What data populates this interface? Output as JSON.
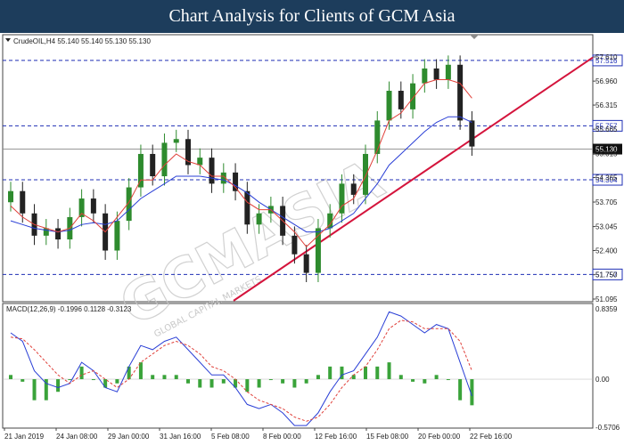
{
  "header": {
    "title": "Chart Analysis for Clients of GCM Asia"
  },
  "price_panel": {
    "info": "CrudeOIL,H4  55.140 55.140 55.130 55.130",
    "watermark": "GCMASIA",
    "watermark_sub": "GLOBAL CAPITAL MARKETS"
  },
  "macd_panel": {
    "info": "MACD(12,26,9) -0.1996 0.1128 -0.3123"
  },
  "colors": {
    "header_bg": "#1d3d5c",
    "bull": "#2e8b2e",
    "bear": "#222222",
    "ma_fast": "#e0403a",
    "ma_slow": "#2a3fd6",
    "trendline": "#d4143c",
    "level_line": "#1f2fb5",
    "macd_line": "#2a3fd6",
    "signal_line": "#e0403a",
    "histogram": "#3aa33a"
  },
  "chart_data": [
    {
      "type": "candlestick",
      "symbol": "CrudeOIL",
      "timeframe": "H4",
      "ohlc": [
        55.14,
        55.14,
        55.13,
        55.13
      ],
      "x_tick_labels": [
        "21 Jan 2019",
        "24 Jan 08:00",
        "29 Jan 00:00",
        "31 Jan 16:00",
        "5 Feb 08:00",
        "8 Feb 00:00",
        "12 Feb 16:00",
        "15 Feb 08:00",
        "20 Feb 00:00",
        "22 Feb 16:00"
      ],
      "y_tick_labels": [
        "57.610",
        "56.960",
        "56.315",
        "55.665",
        "55.015",
        "54.365",
        "53.705",
        "53.045",
        "52.400",
        "51.750",
        "51.095"
      ],
      "ylim": [
        51.095,
        57.61
      ],
      "levels": [
        57.516,
        55.757,
        54.304,
        51.757
      ],
      "current_price": 55.13,
      "trendline": {
        "from": [
          "8 Feb 00:00",
          51.05
        ],
        "to": [
          "22 Feb 16:00",
          55.16
        ]
      },
      "series": [
        {
          "values": [
            54.0,
            53.4,
            52.8,
            53.0,
            52.7,
            53.3,
            53.8,
            53.4,
            52.4,
            53.2,
            54.1,
            55.0,
            54.4,
            55.3,
            55.4,
            54.7,
            54.9,
            54.2,
            54.5,
            54.0,
            53.1,
            53.4,
            53.6,
            52.8,
            52.3,
            51.8,
            53.0,
            53.4,
            54.2,
            53.9,
            55.0,
            55.9,
            56.7,
            56.2,
            56.9,
            57.3,
            57.0,
            57.4,
            55.9,
            55.2
          ]
        },
        {
          "values": [
            53.6,
            53.3,
            53.1,
            53.0,
            52.9,
            53.0,
            53.4,
            53.2,
            52.9,
            53.3,
            53.7,
            54.3,
            54.3,
            54.7,
            55.0,
            54.8,
            54.7,
            54.4,
            54.4,
            54.1,
            53.7,
            53.5,
            53.5,
            53.2,
            52.9,
            52.5,
            52.8,
            53.1,
            53.6,
            53.8,
            54.4,
            55.1,
            55.9,
            56.1,
            56.5,
            56.9,
            57.0,
            57.0,
            56.9,
            56.5
          ]
        },
        {
          "values": [
            53.2,
            53.1,
            53.0,
            52.95,
            52.9,
            52.95,
            53.1,
            53.15,
            53.1,
            53.2,
            53.5,
            53.8,
            54.0,
            54.2,
            54.4,
            54.4,
            54.4,
            54.35,
            54.3,
            54.15,
            53.95,
            53.7,
            53.5,
            53.3,
            53.1,
            52.9,
            52.9,
            53.0,
            53.2,
            53.4,
            53.8,
            54.2,
            54.7,
            55.0,
            55.3,
            55.6,
            55.85,
            56.0,
            56.0,
            55.85
          ]
        }
      ]
    },
    {
      "type": "line",
      "name": "MACD(12,26,9)",
      "values": [
        -0.1996,
        0.1128,
        -0.3123
      ],
      "y_tick_labels": [
        "0.8359",
        "0.00",
        "-0.5706"
      ],
      "ylim": [
        -0.5706,
        0.8359
      ],
      "series": [
        {
          "values": [
            0.55,
            0.45,
            0.1,
            -0.05,
            -0.1,
            -0.05,
            0.2,
            0.1,
            -0.1,
            -0.15,
            0.15,
            0.4,
            0.35,
            0.45,
            0.5,
            0.35,
            0.2,
            0.05,
            0.05,
            -0.1,
            -0.3,
            -0.35,
            -0.3,
            -0.4,
            -0.55,
            -0.55,
            -0.4,
            -0.15,
            0.05,
            0.1,
            0.3,
            0.5,
            0.8,
            0.75,
            0.65,
            0.55,
            0.65,
            0.6,
            0.2,
            -0.2
          ]
        },
        {
          "values": [
            0.5,
            0.48,
            0.35,
            0.2,
            0.05,
            -0.05,
            0.05,
            0.1,
            0.0,
            -0.1,
            0.0,
            0.2,
            0.3,
            0.4,
            0.45,
            0.4,
            0.3,
            0.15,
            0.1,
            0.0,
            -0.15,
            -0.25,
            -0.3,
            -0.35,
            -0.45,
            -0.5,
            -0.45,
            -0.3,
            -0.1,
            0.05,
            0.15,
            0.35,
            0.6,
            0.7,
            0.68,
            0.6,
            0.6,
            0.6,
            0.45,
            0.1
          ]
        },
        {
          "values": [
            0.05,
            -0.03,
            -0.25,
            -0.25,
            -0.15,
            0.0,
            0.15,
            0.0,
            -0.1,
            -0.05,
            0.15,
            0.2,
            0.05,
            0.05,
            0.05,
            -0.05,
            -0.1,
            -0.1,
            -0.05,
            -0.1,
            -0.15,
            -0.1,
            0.0,
            -0.05,
            -0.1,
            -0.05,
            0.05,
            0.15,
            0.15,
            0.05,
            0.15,
            0.15,
            0.2,
            0.05,
            -0.03,
            -0.05,
            0.05,
            0.0,
            -0.25,
            -0.31
          ]
        }
      ]
    }
  ]
}
